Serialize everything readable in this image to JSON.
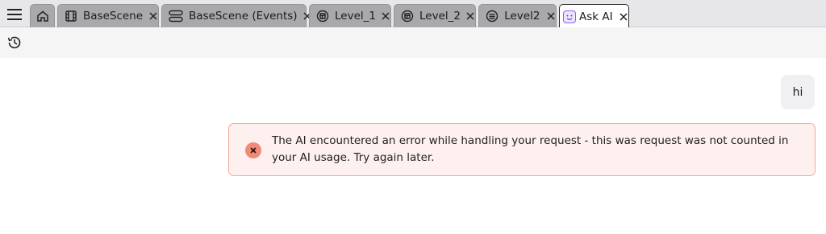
{
  "tabs": [
    {
      "icon": "home-icon",
      "label": ""
    },
    {
      "icon": "film-scene-icon",
      "label": "BaseScene"
    },
    {
      "icon": "events-icon",
      "label": "BaseScene (Events)"
    },
    {
      "icon": "layout-icon",
      "label": "Level_1"
    },
    {
      "icon": "layout-icon",
      "label": "Level_2"
    },
    {
      "icon": "layers-icon",
      "label": "Level2"
    },
    {
      "icon": "ask-ai-icon",
      "label": "Ask AI"
    }
  ],
  "chat": {
    "user_message": "hi",
    "error_message": "The AI encountered an error while handling your request - this was request was not counted in your AI usage. Try again later."
  },
  "colors": {
    "tab_inactive": "#a9a8ad",
    "tab_active": "#ffffff",
    "error_background": "#fdf0ee",
    "error_border": "#f2a9a0",
    "error_icon": "#f08a76",
    "ai_icon_accent": "#8b5cf6"
  }
}
